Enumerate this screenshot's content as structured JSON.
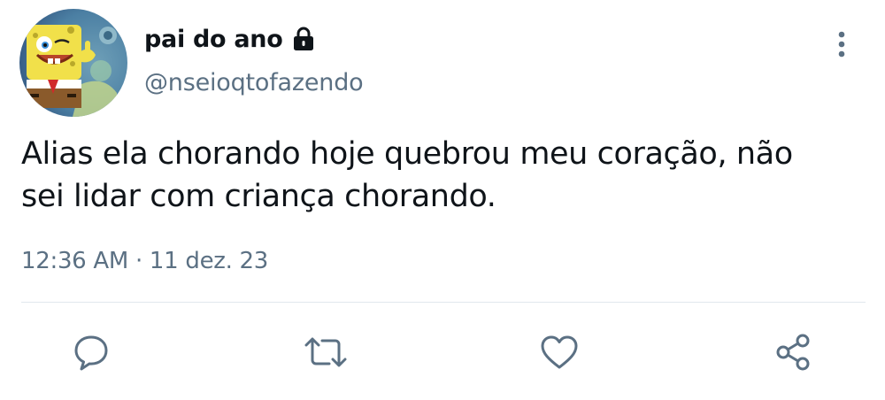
{
  "author": {
    "display_name": "pai do ano",
    "handle": "@nseioqtofazendo",
    "protected_icon": "lock-icon",
    "avatar": "avatar-image"
  },
  "tweet": {
    "text_line1": "Alias ela chorando hoje quebrou meu coração, não",
    "text_line2": "sei lidar com criança chorando."
  },
  "meta": {
    "time": "12:36 AM",
    "separator": "·",
    "date": "11 dez. 23"
  },
  "actions": {
    "reply_icon": "reply-icon",
    "retweet_icon": "retweet-icon",
    "like_icon": "heart-icon",
    "share_icon": "share-icon",
    "more_icon": "more-vertical-icon"
  },
  "colors": {
    "text": "#0f1419",
    "secondary": "#5b7083",
    "divider": "#e1e8ed",
    "icon": "#5b7083"
  }
}
